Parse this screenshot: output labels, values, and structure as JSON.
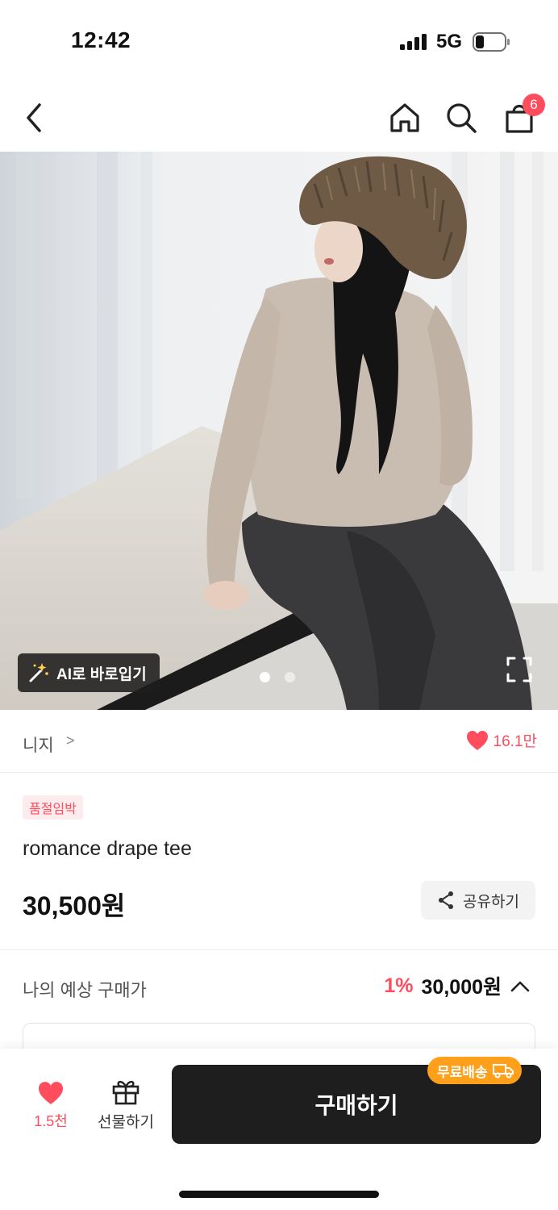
{
  "status_bar": {
    "time": "12:42",
    "network": "5G"
  },
  "nav": {
    "cart_count": "6",
    "icons": [
      "back-arrow-icon",
      "home-icon",
      "search-icon",
      "shopping-bag-icon"
    ]
  },
  "hero": {
    "ai_button_label": "AI로 바로입기",
    "total_images": 2,
    "active_image": 1
  },
  "brand": {
    "name": "니지",
    "arrow": ">",
    "like_count": "16.1만"
  },
  "product": {
    "badge": "품절임박",
    "name": "romance drape tee",
    "price": "30,500원",
    "share_label": "공유하기"
  },
  "expected_price": {
    "label": "나의 예상 구매가",
    "discount": "1%",
    "price": "30,000원"
  },
  "bottom_bar": {
    "like_count": "1.5천",
    "gift_label": "선물하기",
    "buy_label": "구매하기",
    "free_shipping_label": "무료배송"
  },
  "colors": {
    "accent": "#ff4d5e",
    "buy_button": "#1e1e1e",
    "free_shipping": "#ff9f1a"
  }
}
